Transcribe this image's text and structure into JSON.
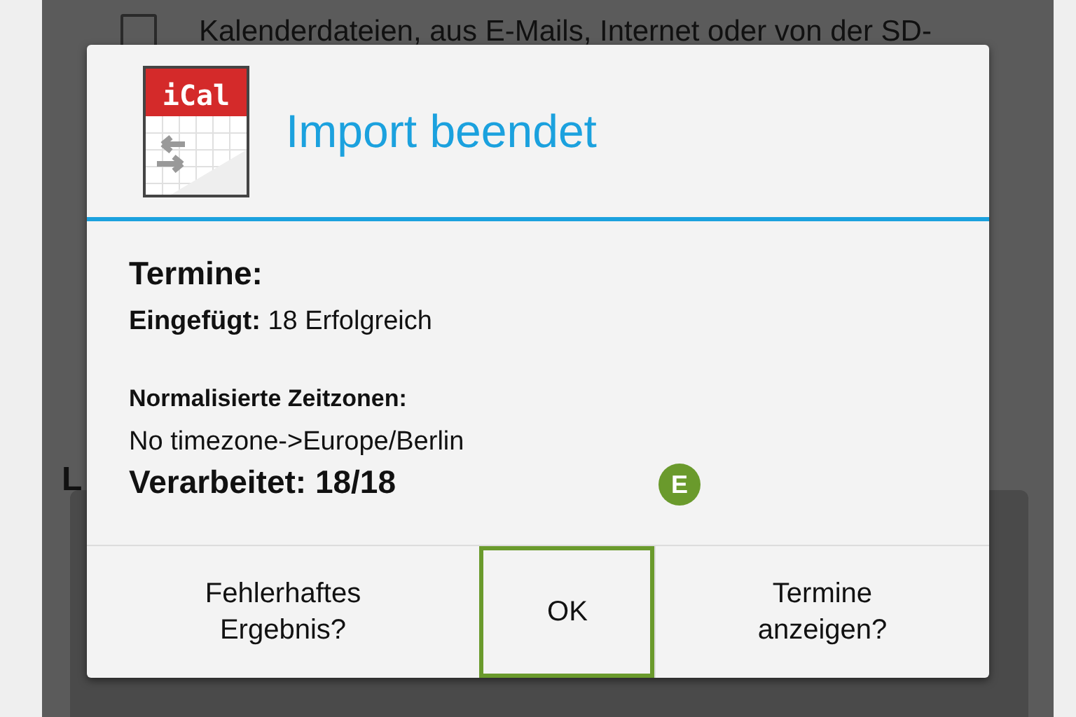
{
  "background": {
    "checkbox": {
      "checked": false
    },
    "text": "Kalenderdateien, aus E-Mails, Internet oder von der SD-",
    "letter": "L"
  },
  "dialog": {
    "title": "Import beendet",
    "icon_label": "iCal",
    "sections": [
      {
        "kind": "heading",
        "text": "Termine:"
      },
      {
        "kind": "line",
        "text": "**Eingefügt:** 18 Erfolgreich"
      },
      {
        "kind": "spacer"
      },
      {
        "kind": "subheading",
        "text": "Normalisierte Zeitzonen:"
      },
      {
        "kind": "line",
        "text": "No timezone->Europe/Berlin"
      },
      {
        "kind": "total",
        "text": "Verarbeitet: 18/18"
      }
    ],
    "buttons": [
      {
        "label": "Fehlerhaftes Ergebnis?",
        "highlighted": false
      },
      {
        "label": "OK",
        "highlighted": true
      },
      {
        "label": "Termine anzeigen?",
        "highlighted": false
      }
    ]
  },
  "annotation": {
    "badge": "E"
  }
}
